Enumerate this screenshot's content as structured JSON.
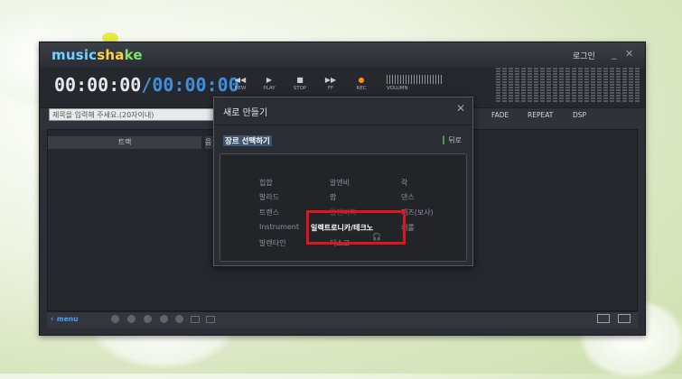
{
  "app": {
    "logo_parts": [
      "music",
      "sha",
      "ke"
    ],
    "login_label": "로그인",
    "minimize_glyph": "_",
    "close_glyph": "✕"
  },
  "transport": {
    "time_elapsed": "00:00:00",
    "time_separator": "/",
    "time_total": "00:00:00",
    "controls": [
      {
        "label": "REW",
        "icon": "◀◀"
      },
      {
        "label": "PLAY",
        "icon": "▶"
      },
      {
        "label": "STOP",
        "icon": "■"
      },
      {
        "label": "FF",
        "icon": "▶▶"
      },
      {
        "label": "REC",
        "icon": "●"
      }
    ],
    "volume_label": "VOLUMN"
  },
  "editor": {
    "title_placeholder": "제목을 입력해 주세요.(20자이내)",
    "tools": [
      "FADE",
      "REPEAT",
      "DSP"
    ],
    "track_header": "트랙",
    "track_header2": "음"
  },
  "bottom": {
    "menu_label": "⚡ menu"
  },
  "dialog": {
    "title": "새로 만들기",
    "close_glyph": "✕",
    "section_title": "장르 선택하기",
    "back_label": "뒤로",
    "back_icon": "║",
    "genres": [
      "힙합",
      "알엔비",
      "락",
      "발라드",
      "팝",
      "댄스",
      "트랜스",
      "알앤비치",
      "재즈(보사)",
      "Instrument",
      "일렉트로니카/테크노",
      "캐롤",
      "발렌타인",
      "디스코"
    ],
    "selected_genre": "일렉트로니카/테크노",
    "headphone_icon": "🎧"
  },
  "colors": {
    "accent_blue": "#3e8fe0",
    "rec_orange": "#ff8a1a",
    "highlight_red": "#e0141a"
  }
}
